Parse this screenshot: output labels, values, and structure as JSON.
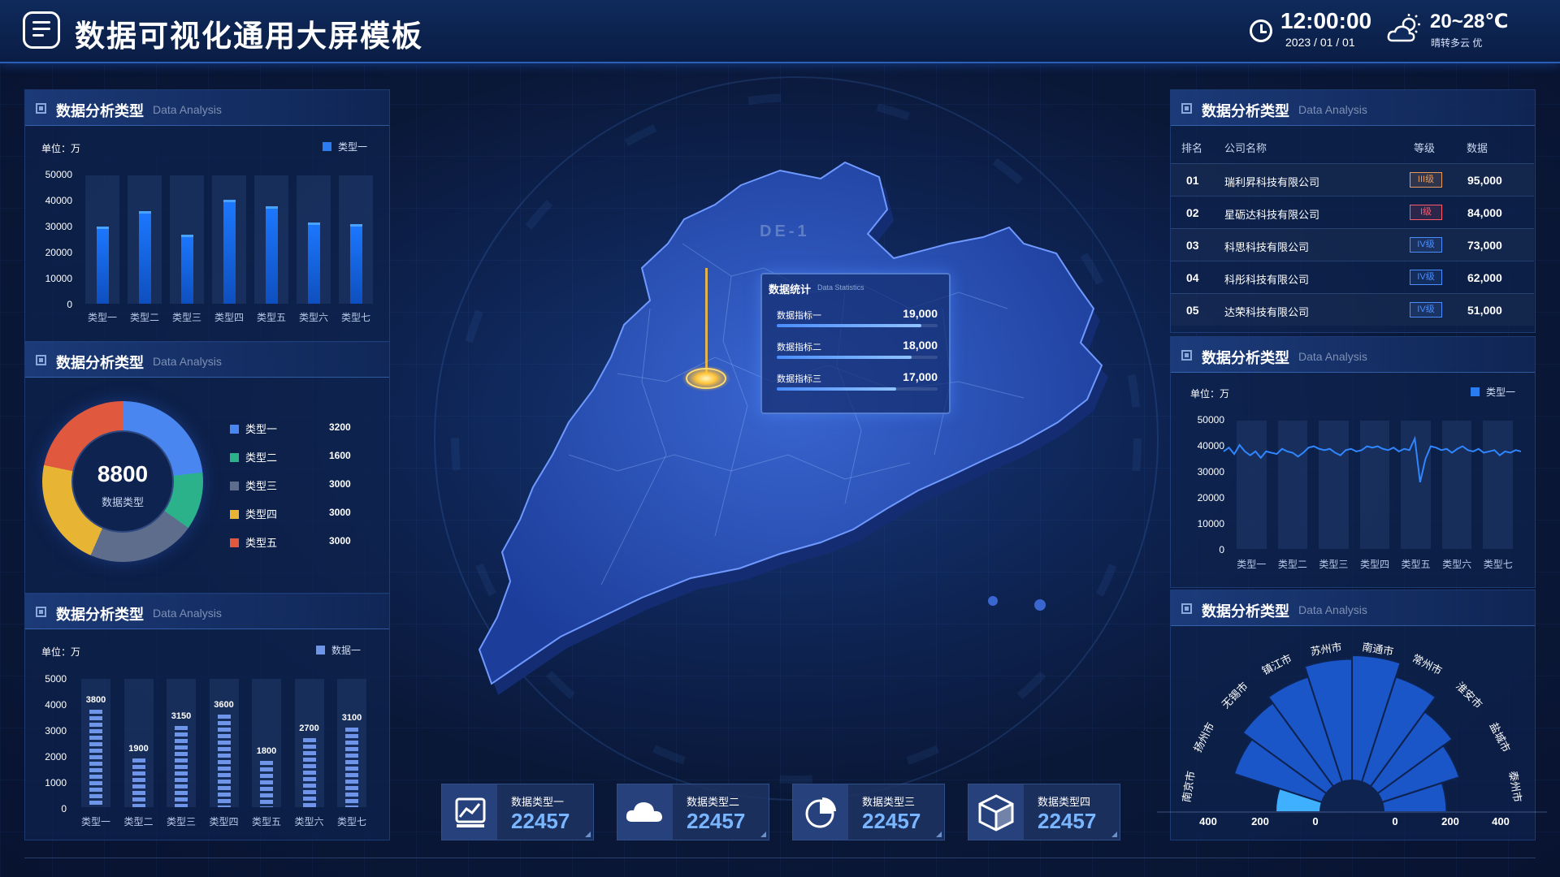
{
  "header": {
    "title": "数据可视化通用大屏模板",
    "time": "12:00:00",
    "date": "2023 / 01 / 01",
    "temperature": "20~28℃",
    "weather": "晴转多云  优",
    "icons": [
      "menu-logo-icon",
      "clock-icon",
      "cloud-sun-icon"
    ]
  },
  "panel_title": "数据分析类型",
  "panel_title_en": "Data Analysis",
  "colors": {
    "accent": "#2a7cf0",
    "bar": "#1c78ff",
    "seg": "#6f95e8",
    "gold": "#e7b533"
  },
  "left_bar": {
    "unit": "单位：万",
    "legend": "类型一",
    "chart_data": {
      "type": "bar",
      "categories": [
        "类型一",
        "类型二",
        "类型三",
        "类型四",
        "类型五",
        "类型六",
        "类型七"
      ],
      "series": [
        {
          "name": "类型一",
          "values": [
            30000,
            36000,
            27000,
            40500,
            38000,
            31500,
            31000
          ]
        }
      ],
      "ylim": [
        0,
        50000
      ],
      "yticks": [
        "50000",
        "40000",
        "30000",
        "20000",
        "10000",
        "0"
      ]
    }
  },
  "donut": {
    "center_value": "8800",
    "center_label": "数据类型",
    "chart_data": {
      "type": "pie",
      "categories": [
        "类型一",
        "类型二",
        "类型三",
        "类型四",
        "类型五"
      ],
      "values": [
        3200,
        1600,
        3000,
        3000,
        3000
      ],
      "display_values": [
        "3200",
        "1600",
        "3000",
        "3000",
        "3000"
      ],
      "colors": [
        "#4a86f0",
        "#2bb28a",
        "#5e6d8c",
        "#e7b533",
        "#e0583e"
      ]
    }
  },
  "left_seg_bar": {
    "unit": "单位：万",
    "legend": "数据一",
    "chart_data": {
      "type": "bar",
      "categories": [
        "类型一",
        "类型二",
        "类型三",
        "类型四",
        "类型五",
        "类型六",
        "类型七"
      ],
      "series": [
        {
          "name": "数据一",
          "values": [
            3800,
            1900,
            3150,
            3600,
            1800,
            2700,
            3100
          ]
        }
      ],
      "labels": [
        "3800",
        "1900",
        "3150",
        "3600",
        "1800",
        "2700",
        "3100"
      ],
      "ylim": [
        0,
        5000
      ],
      "yticks": [
        "5000",
        "4000",
        "3000",
        "2000",
        "1000",
        "0"
      ]
    }
  },
  "map": {
    "tag": "DE-1",
    "stats_title": "数据统计",
    "stats_title_en": "Data Statistics",
    "metrics": [
      {
        "label": "数据指标一",
        "value": "19,000",
        "pct": 0.9
      },
      {
        "label": "数据指标二",
        "value": "18,000",
        "pct": 0.84
      },
      {
        "label": "数据指标三",
        "value": "17,000",
        "pct": 0.74
      }
    ]
  },
  "cards": [
    {
      "label": "数据类型一",
      "value": "22457",
      "icon": "trend-chart-icon"
    },
    {
      "label": "数据类型二",
      "value": "22457",
      "icon": "cloud-icon"
    },
    {
      "label": "数据类型三",
      "value": "22457",
      "icon": "pie-chart-icon"
    },
    {
      "label": "数据类型四",
      "value": "22457",
      "icon": "cube-icon"
    }
  ],
  "ranking": {
    "headers": [
      "排名",
      "公司名称",
      "等级",
      "数据"
    ],
    "rows": [
      {
        "rank": "01",
        "name": "瑞利昇科技有限公司",
        "level": "III级",
        "value": "95,000",
        "color": "#e89a5a"
      },
      {
        "rank": "02",
        "name": "星砺达科技有限公司",
        "level": "I级",
        "value": "84,000",
        "color": "#ff5a6a"
      },
      {
        "rank": "03",
        "name": "科思科技有限公司",
        "level": "IV级",
        "value": "73,000",
        "color": "#4a8dff"
      },
      {
        "rank": "04",
        "name": "科彤科技有限公司",
        "level": "IV级",
        "value": "62,000",
        "color": "#4a8dff"
      },
      {
        "rank": "05",
        "name": "达荣科技有限公司",
        "level": "IV级",
        "value": "51,000",
        "color": "#4a8dff"
      }
    ]
  },
  "right_line": {
    "unit": "单位：万",
    "legend": "类型一",
    "chart_data": {
      "type": "line",
      "categories": [
        "类型一",
        "类型二",
        "类型三",
        "类型四",
        "类型五",
        "类型六",
        "类型七"
      ],
      "series": [
        {
          "name": "类型一",
          "values": [
            38000,
            39500,
            37000,
            40500,
            38000,
            36500,
            38000,
            35500,
            38000,
            37500,
            37000,
            39000,
            38000,
            37500,
            36000,
            37500,
            39500,
            40000,
            39000,
            38500,
            39000,
            37500,
            36500,
            38500,
            39000,
            38000,
            38500,
            40000,
            39500,
            40000,
            39000,
            38500,
            39500,
            38000,
            39000,
            38500,
            43000,
            26000,
            35000,
            40000,
            39500,
            38500,
            39000,
            37500,
            39000,
            40000,
            38500,
            38000,
            39000,
            37500,
            38000,
            38500,
            36500,
            38000,
            37500,
            38500,
            38000
          ]
        }
      ],
      "ylim": [
        0,
        50000
      ],
      "yticks": [
        "50000",
        "40000",
        "30000",
        "20000",
        "10000",
        "0"
      ]
    }
  },
  "rose": {
    "cities": [
      "南京市",
      "扬州市",
      "无锡市",
      "镇江市",
      "苏州市",
      "南通市",
      "常州市",
      "淮安市",
      "盐城市",
      "泰州市"
    ],
    "axis_labels": [
      "400",
      "200",
      "0",
      "0",
      "200",
      "400"
    ],
    "chart_data": {
      "type": "bar",
      "categories": [
        "南京市",
        "扬州市",
        "无锡市",
        "镇江市",
        "苏州市",
        "南通市",
        "常州市",
        "淮安市",
        "盐城市",
        "泰州市"
      ],
      "values": [
        120,
        250,
        280,
        300,
        330,
        340,
        300,
        250,
        220,
        170
      ],
      "xlim": [
        0,
        400
      ]
    }
  }
}
